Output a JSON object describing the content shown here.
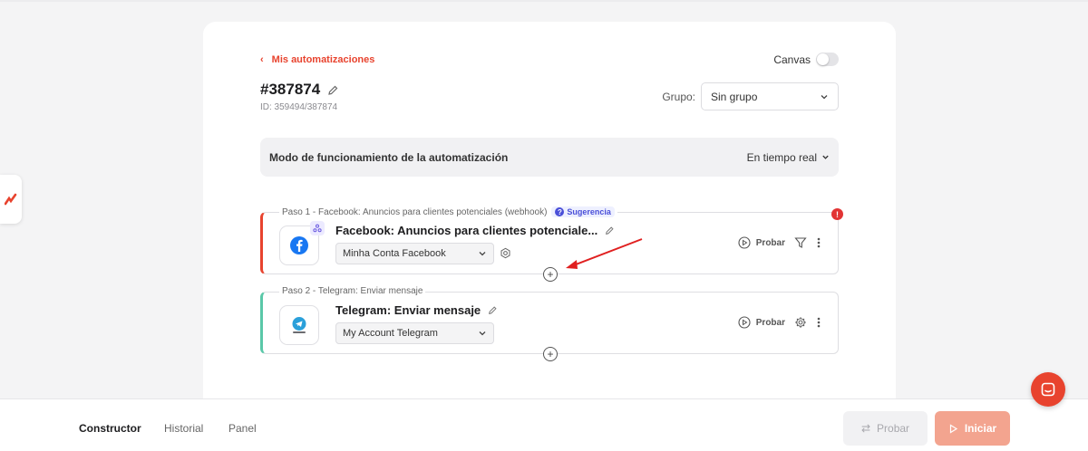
{
  "colors": {
    "accent": "#e8432e",
    "step1_border": "#e8432e",
    "step2_border": "#5ac8a8",
    "alert": "#e23434"
  },
  "header": {
    "back_link": "Mis automatizaciones",
    "canvas_label": "Canvas",
    "title": "#387874",
    "id_text": "ID: 359494/387874",
    "grupo_label": "Grupo:",
    "grupo_value": "Sin grupo"
  },
  "mode": {
    "label": "Modo de funcionamiento de la automatización",
    "value": "En tiempo real"
  },
  "steps": [
    {
      "caption": "Paso 1 - Facebook: Anuncios para clientes potenciales (webhook)",
      "suggestion": "Sugerencia",
      "title": "Facebook: Anuncios para clientes potenciale...",
      "account": "Minha Conta Facebook",
      "probar": "Probar",
      "icon": "facebook-icon"
    },
    {
      "caption": "Paso 2 - Telegram: Enviar mensaje",
      "title": "Telegram: Enviar mensaje",
      "account": "My Account Telegram",
      "probar": "Probar",
      "icon": "telegram-icon"
    }
  ],
  "footer": {
    "tabs": [
      "Constructor",
      "Historial",
      "Panel"
    ],
    "probar_button": "Probar",
    "iniciar_button": "Iniciar"
  }
}
